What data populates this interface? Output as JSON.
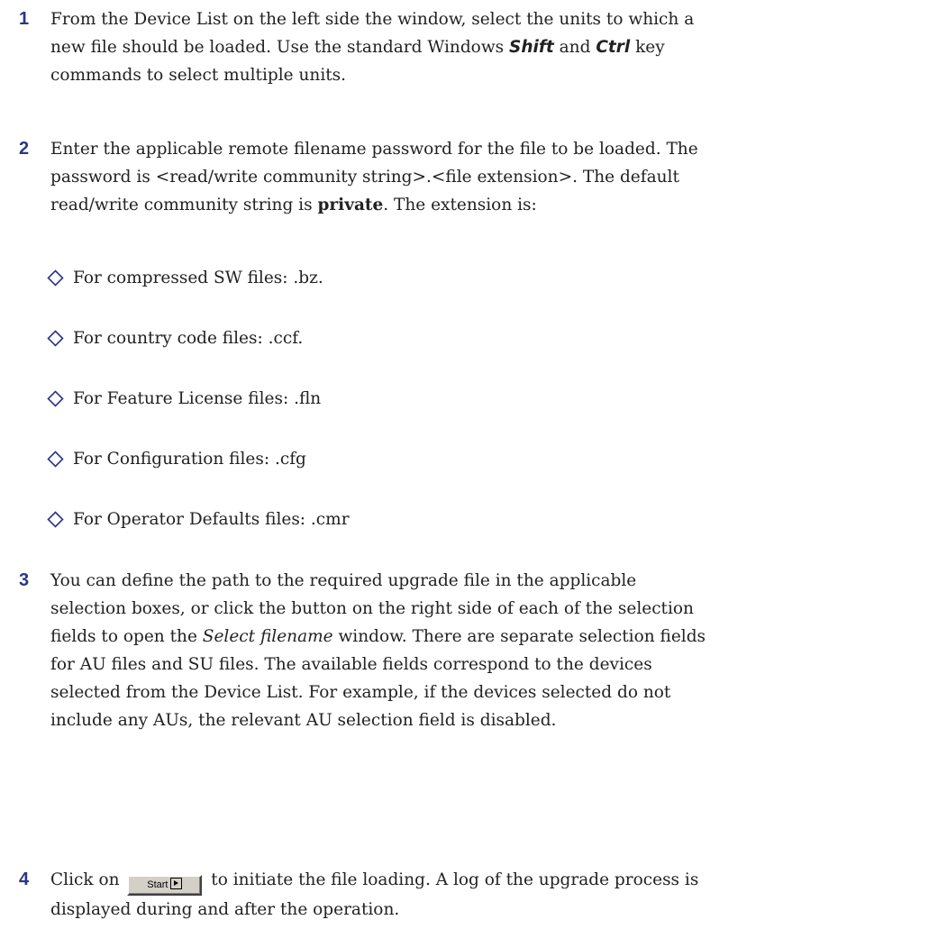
{
  "steps": [
    {
      "number": "1",
      "line1": "From the Device List on the left side the window, select the units to which a",
      "line2_a": "new file should be loaded. Use the standard Windows ",
      "line2_shift": "Shift",
      "line2_and": " and ",
      "line2_ctrl": "Ctrl",
      "line2_b": " key",
      "line3": "commands to select multiple units."
    },
    {
      "number": "2",
      "line1": "Enter the applicable remote filename password for the file to be loaded. The",
      "line2": "password is <read/write community string>.<file extension>. The default",
      "line3_a": "read/write community string is ",
      "line3_bold": "private",
      "line3_b": ". The extension is:"
    },
    {
      "number": "3",
      "line1": "You can define the path to the required upgrade file in the applicable",
      "line2": "selection boxes, or click the button on the right side of each of the selection",
      "line3_a": "fields to open the ",
      "line3_italic": "Select filename",
      "line3_b": " window. There are separate selection fields",
      "line4": "for AU files and SU files. The available fields correspond to the devices",
      "line5": "selected from the Device List. For example, if the devices selected do not",
      "line6": "include any AUs, the relevant AU selection field is disabled."
    },
    {
      "number": "4",
      "line1_a": "Click on ",
      "line1_b": " to initiate the file loading. A log of the upgrade process is",
      "line2": "displayed during and after the operation."
    }
  ],
  "extensions": [
    "For compressed SW files: .bz.",
    "For country code files: .ccf.",
    "For Feature License files: .fln",
    "For Configuration files: .cfg",
    "For Operator Defaults files: .cmr"
  ],
  "start_button": {
    "label": "Start"
  },
  "colors": {
    "step_number": "#2b3585",
    "bullet_outline": "#2b3585",
    "body_text": "#222222"
  },
  "icons": {
    "bullet": "diamond-outline-icon",
    "start_arrow": "play-arrow-icon"
  }
}
